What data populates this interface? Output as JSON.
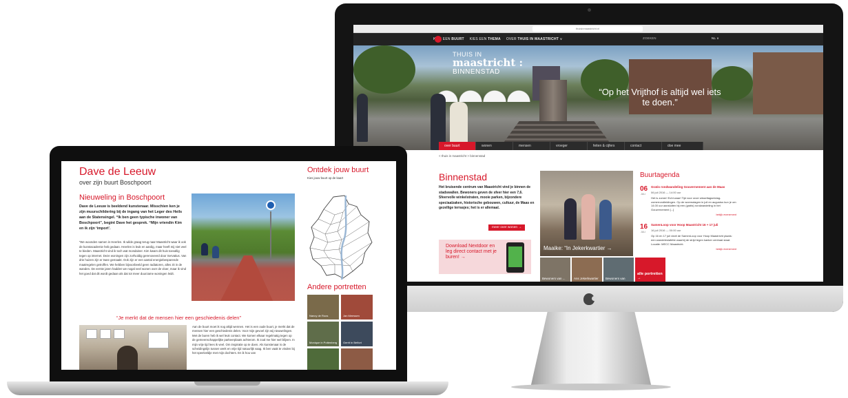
{
  "desktop": {
    "url": "thuisinmaastricht.nl",
    "nav": [
      {
        "pre": "KIES EEN ",
        "bold": "BUURT"
      },
      {
        "pre": "KIES EEN ",
        "bold": "THEMA"
      },
      {
        "pre": "OVER ",
        "bold": "THUIS IN MAASTRICHT",
        "post": " ∨"
      }
    ],
    "search": "ZOEKEN",
    "language": "NL ∨",
    "hero": {
      "title_line1": "THUIS IN",
      "title_line2": "maastricht :",
      "title_line3": "BINNENSTAD",
      "quote": "“Op het Vrijthof is altijd wel iets te doen.”"
    },
    "tabs": [
      "over buurt",
      "wonen",
      "mensen",
      "vroeger",
      "feiten & cijfers",
      "contact",
      "doe mee"
    ],
    "breadcrumb": "< thuis in maastricht  > binnenstad",
    "page_title": "Binnenstad",
    "intro": "Het bruisende centrum van Maastricht vind je binnen de stadswallen. Bewoners geven de sfeer hier een 7,6. Sfeervolle winkelstraten, mooie parken, bijzondere speciaalzaken, historische gebouwen, cultuur, de Maas en gezellige terrasjes; het is er allemaal.",
    "more_button": "meer over wonen →",
    "promo": "Download Nextdoor en leg direct contact met je buren! →",
    "photo_caption": "Maaike: “In Jekerkwartier →",
    "thumbs": [
      "Bewoners van ...",
      "Ans Jekerkwartier",
      "Bewoners van",
      "alle portretten →"
    ],
    "agenda": {
      "title": "Buurtagenda",
      "items": [
        {
          "day": "06",
          "month": "JULI",
          "title": "Gratis rondwandeling Gouvernement aan de Maas",
          "date": "06 juli 2016 — 14:00 uur",
          "desc": "Het is zomer! Echt waar! Tijd voor onze wisseltagsmidag-zomerrondleidingen. Op de woensdagen in juli en augustus kun je om 14.00 uur aansluiten bij een (gratis) rondwandeling in het Gouvernement [...]",
          "more": "bekijk evenement"
        },
        {
          "day": "16",
          "month": "JULI",
          "title": "SamenLoop voor Hoop Maastricht 16 + 17 juli",
          "date": "16 juli 2016 — 00:00 uur",
          "desc": "Op 16 en 17 juli vindt de SamenLoop voor Hoop Maastricht plaats: een wandelestafette waarbij de strijd tegen kanker centraal staat. Locatie: MECC Maastricht.",
          "more": "bekijk evenement"
        }
      ]
    }
  },
  "laptop": {
    "name": "Dave de Leeuw",
    "subtitle": "over zijn buurt Boschpoort",
    "section_title": "Nieuweling in Boschpoort",
    "intro": "Dave de Leeuw is beeldend kunstenaar. Misschien ken je zijn muurschildering bij de ingang van het Leger des Heils aan de Statensingel. “Ik ben geen typische inwoner van Boschpoort”, begint Dave het gesprek. “Mijn vriendin Kim en ik zijn ‘import’.",
    "body": "“We woonden samen in Heerlen. Ik wilde graag terug naar Maastricht waar ik ook de kunstacademie heb gedaan. Heerlen is leuk en aardig, maar heeft mij niet veel te bieden. Maastricht vind ik toch wat mondainer. Kim kwam dit huis toevallig tegen op internet. Deze woningen zijn zorfvuldig gerenoveerd door Servatius. Van drie huizen zijn er twee gemaakt. Ook zijn er een aantal energiebesparende maatregelen getroffen. We hebben bijvoorbeeld geen radiatoren, alles zit in de wanden. De eerste jaren hadden we nogal veel wonen over de vloer, maar ik vind het goed dat dit wordt gedaan als dat tot meer duurzame woningen leidt.",
    "quote": "“Je merkt dat de mensen hier een geschiedenis delen”",
    "body2": "Aan de buurt moet ik nog altijd wennen. Het is een oude buurt, je merkt dat de mensen hier een geschiedenis delen. Voor mijn gevoel zijn wij nieuwelingen. Met de buren heb ik wel leuk contact. We komen elkaar regelmatig tegen op de gemeenschappelijke parkeerplaats achterom. Ik zoal me hier wel blijven. In mijn vrije tijd lees ik veel. Om inspiratie op te doen. Als kunstenaar is de scheidingslijn tussen werk en vrije tijd natuurlijk vaag. Ik ben vaak te vinden bij het speelveldje met mijn dochters. En ik hou van",
    "side_title": "Ontdek jouw buurt",
    "side_sub": "Kies jouw buurt op de kaart",
    "other_title": "Andere portretten",
    "portraits": [
      "Nancy de Roos",
      "Jan Meessen",
      "Monique in Pottenberg",
      "Gerrit in Belfort",
      "",
      ""
    ]
  },
  "colors": {
    "accent": "#d7182a",
    "nav_dark": "#222222",
    "promo_bg": "#f6d8db"
  }
}
